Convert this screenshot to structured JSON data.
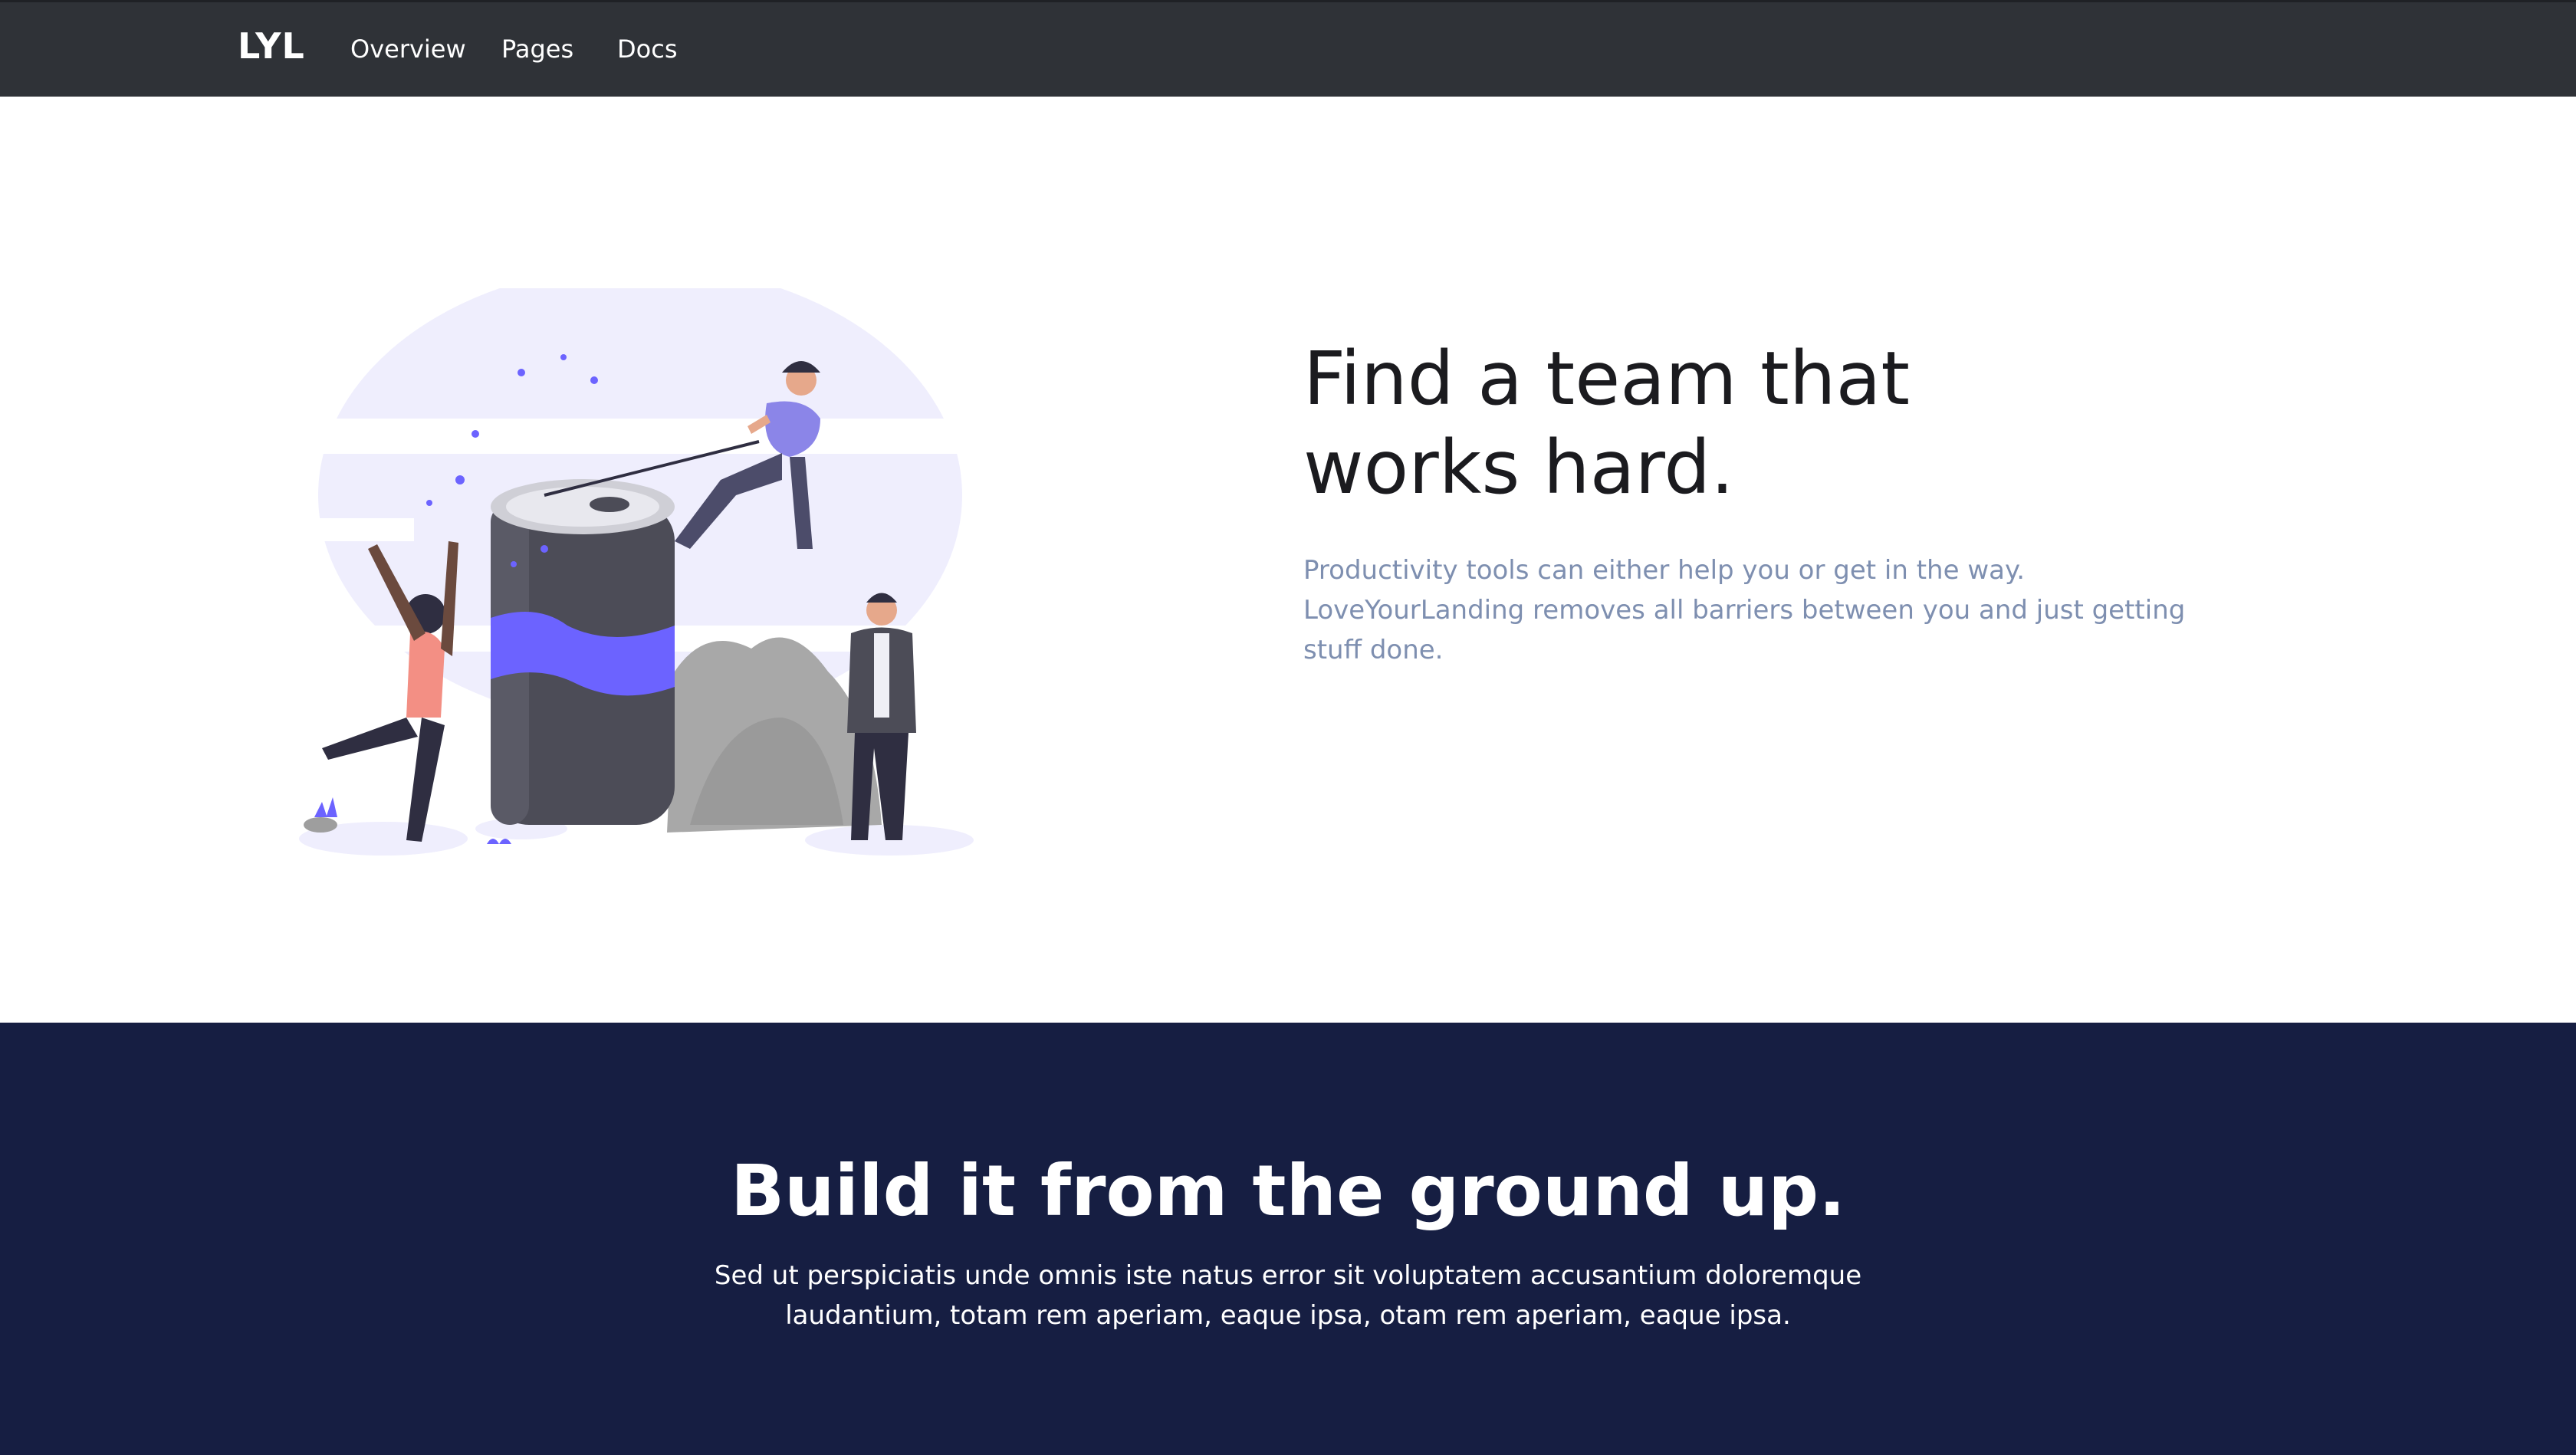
{
  "navbar": {
    "brand": "LYL",
    "links": [
      "Overview",
      "Pages",
      "Docs"
    ]
  },
  "hero": {
    "title": "Find a team that works hard.",
    "text": "Productivity tools can either help you or get in the way. LoveYourLanding removes all barriers between you and just getting stuff done.",
    "illustration_icon": "team-climbing-can-illustration"
  },
  "feature": {
    "title": "Build it from the ground up.",
    "text": "Sed ut perspiciatis unde omnis iste natus error sit voluptatem accusantium doloremque laudantium, totam rem aperiam, eaque ipsa, otam rem aperiam, eaque ipsa."
  },
  "colors": {
    "navbar_bg": "#2f3237",
    "feature_bg": "#161e42",
    "accent": "#6c63ff",
    "muted_text": "#7e8fb0"
  }
}
